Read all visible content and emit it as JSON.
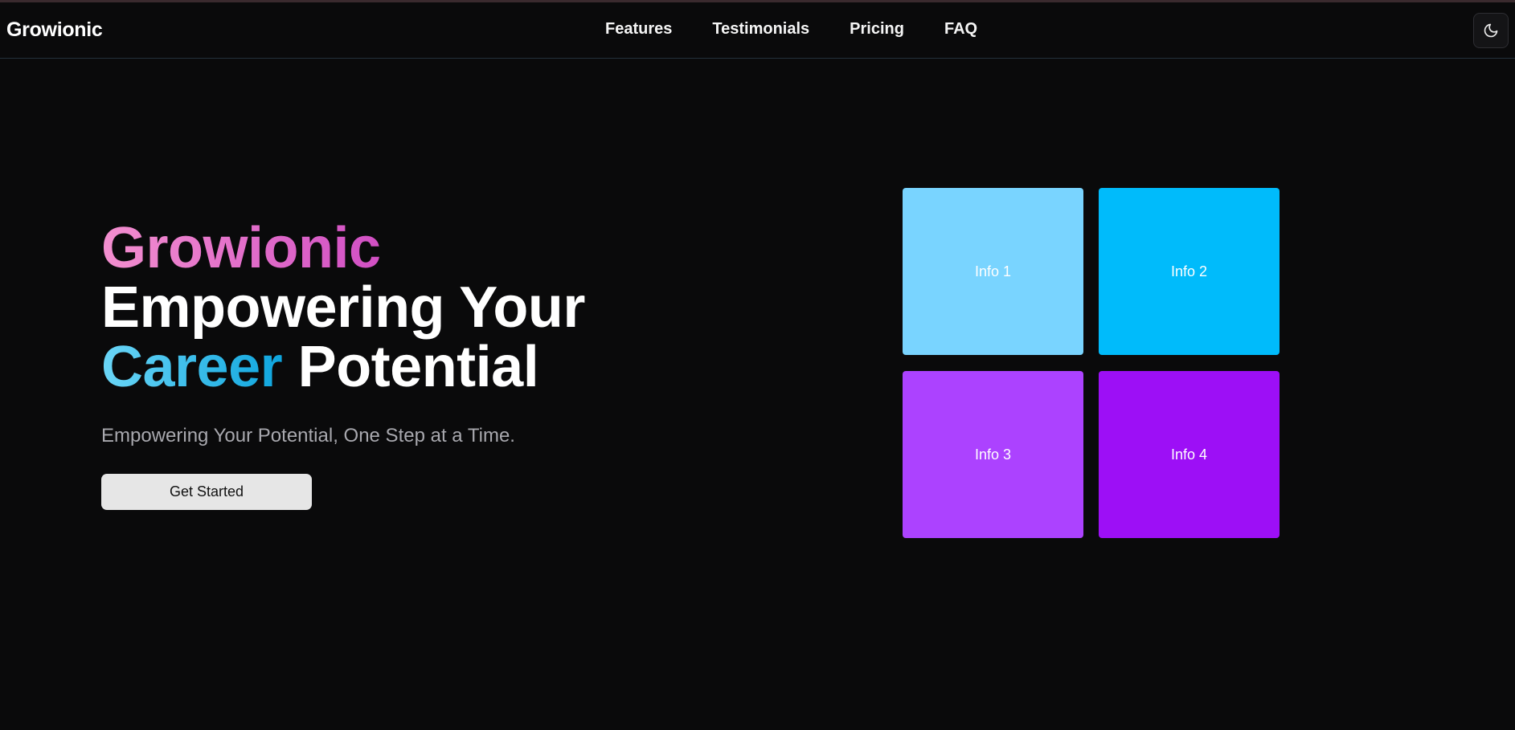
{
  "brand": "Growionic",
  "nav": {
    "items": [
      "Features",
      "Testimonials",
      "Pricing",
      "FAQ"
    ]
  },
  "theme_toggle": {
    "icon": "moon-icon"
  },
  "hero": {
    "title_brand": "Growionic",
    "title_line2": "Empowering Your",
    "title_accent": "Career",
    "title_rest": " Potential",
    "subtitle": "Empowering Your Potential, One Step at a Time.",
    "cta_label": "Get Started"
  },
  "tiles": [
    "Info 1",
    "Info 2",
    "Info 3",
    "Info 4"
  ],
  "colors": {
    "background": "#0a0a0b",
    "brand_gradient": [
      "#f38fcf",
      "#d14fc4"
    ],
    "accent_gradient": [
      "#6bd6f7",
      "#0ea5de"
    ],
    "tile_1": "#79d4ff",
    "tile_2": "#00bbfb",
    "tile_3": "#ac42ff",
    "tile_4": "#9d0ff6"
  }
}
